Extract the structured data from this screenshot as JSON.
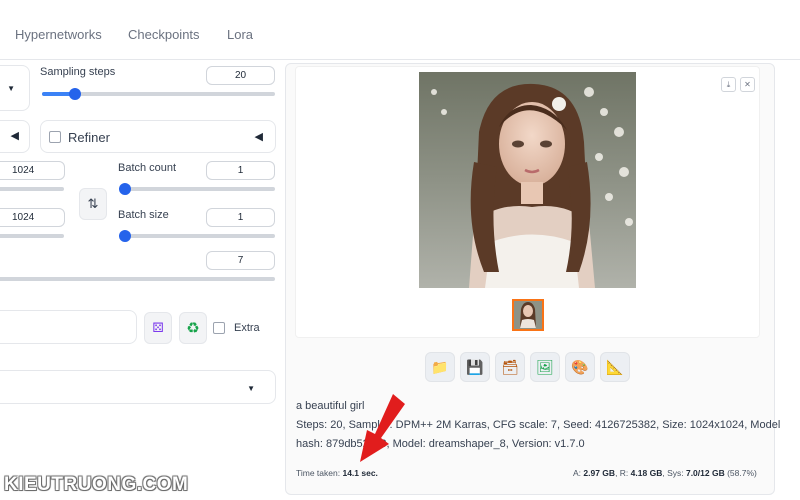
{
  "tabs": [
    "Hypernetworks",
    "Checkpoints",
    "Lora"
  ],
  "sampling_steps": {
    "label": "Sampling steps",
    "value": "20",
    "slider_fraction": 0.14
  },
  "refiner": {
    "label": "Refiner",
    "checked": false
  },
  "width": {
    "value": "1024"
  },
  "height": {
    "value": "1024"
  },
  "swap_icon": "swap-vertical-icon",
  "batch_count": {
    "label": "Batch count",
    "value": "1",
    "slider_fraction": 0.0
  },
  "batch_size": {
    "label": "Batch size",
    "value": "1",
    "slider_fraction": 0.0
  },
  "cfg_scale": {
    "value": "7"
  },
  "seed_tools": {
    "dice_icon": "dice-icon",
    "recycle_icon": "recycle-icon",
    "extra_label": "Extra",
    "extra_checked": false
  },
  "output": {
    "download_icon": "download-icon",
    "close_icon": "close-icon",
    "toolbar": [
      "folder-icon",
      "save-icon",
      "zip-icon",
      "image-icon",
      "palette-icon",
      "ruler-icon"
    ],
    "prompt": "a beautiful girl",
    "params_line1": "Steps: 20, Sampler: DPM++ 2M Karras, CFG scale: 7, Seed: 4126725382, Size: 1024x1024, Model",
    "params_line2": "hash: 879db523c3, Model: dreamshaper_8, Version: v1.7.0",
    "time_label": "Time taken:",
    "time_value": "14.1 sec.",
    "mem_a_label": "A:",
    "mem_a": "2.97 GB",
    "mem_r_label": "R:",
    "mem_r": "4.18 GB",
    "mem_sys_label": "Sys:",
    "mem_sys": "7.0/12 GB",
    "mem_pct": "(58.7%)"
  },
  "watermark": "KIEUTRUONG.COM",
  "colors": {
    "accent": "#2563eb",
    "arrow": "#e11d1d",
    "thumb_border": "#f97316"
  }
}
